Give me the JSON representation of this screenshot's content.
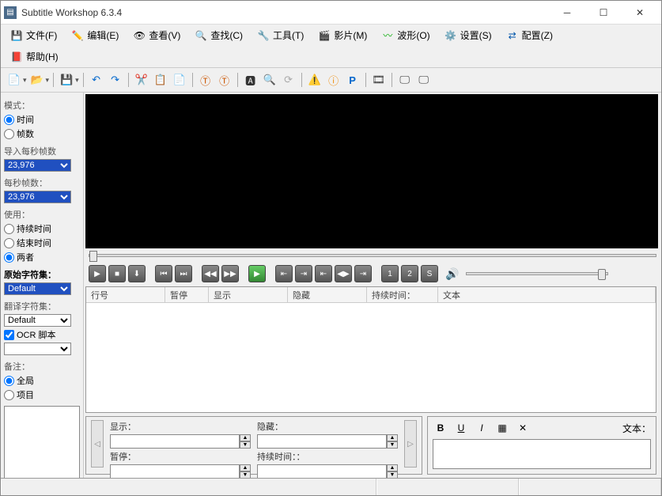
{
  "title": "Subtitle Workshop 6.3.4",
  "menu": {
    "file": "文件(F)",
    "edit": "编辑(E)",
    "view": "查看(V)",
    "search": "查找(C)",
    "tools": "工具(T)",
    "movie": "影片(M)",
    "wave": "波形(O)",
    "settings": "设置(S)",
    "config": "配置(Z)",
    "help": "帮助(H)"
  },
  "sidebar": {
    "mode_label": "模式：",
    "time_radio": "时间",
    "frames_radio": "帧数",
    "input_fps_label": "导入每秒帧数",
    "fps_label": "每秒帧数：",
    "fps_value": "23,976",
    "work_label": "使用：",
    "duration_radio": "持续时间",
    "end_radio": "结束时间",
    "both_radio": "两者",
    "orig_charset_label": "原始字符集：",
    "trans_charset_label": "翻译字符集：",
    "charset_default": "Default",
    "ocr_label": "OCR 脚本",
    "notes_label": "备注：",
    "global_radio": "全局",
    "project_radio": "项目"
  },
  "grid": {
    "col_num": "行号",
    "col_pause": "暂停",
    "col_show": "显示",
    "col_hide": "隐藏",
    "col_duration": "持续时间：",
    "col_text": "文本"
  },
  "bottom": {
    "show_label": "显示：",
    "hide_label": "隐藏：",
    "pause_label": "暂停：",
    "duration_label": "持续时间：：",
    "text_label": "文本："
  },
  "playbar": {
    "b1": "▶",
    "b2": "■",
    "b3": "⬇",
    "b_prev": "⏮",
    "b_next": "⏭",
    "b_rew": "◀◀",
    "b_ff": "▶▶",
    "b_play2": "▶",
    "b_in": "⇤",
    "b_out": "⇥",
    "b_mk1": "⇤",
    "b_mk2": "◀▶",
    "b_mk3": "⇥",
    "b_n1": "1",
    "b_n2": "2",
    "b_s": "S"
  }
}
